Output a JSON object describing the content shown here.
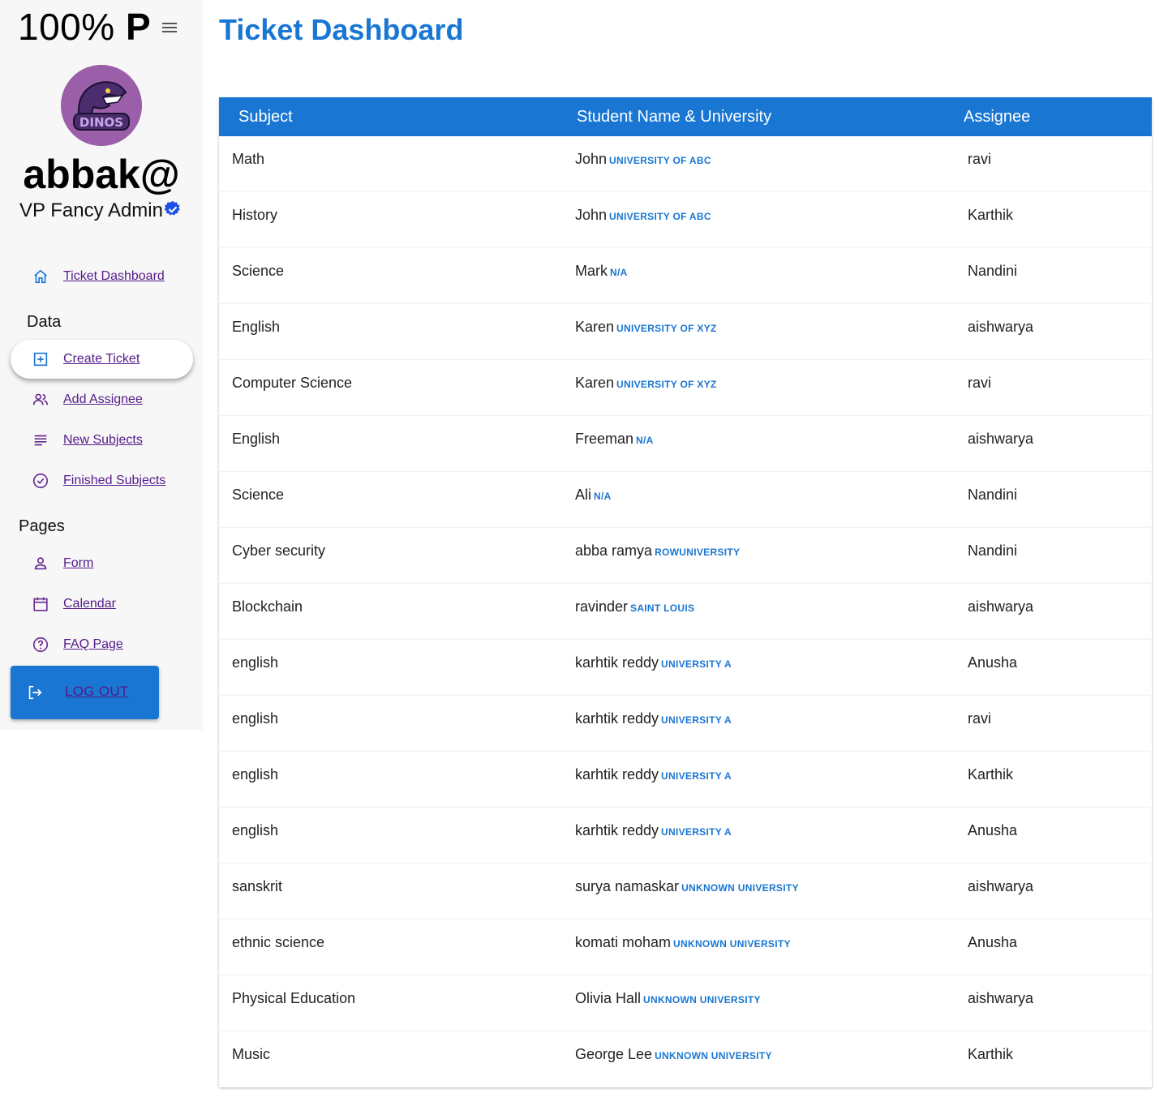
{
  "brand": {
    "prefix": "100%",
    "suffix": "P"
  },
  "user": {
    "name": "abbak@",
    "role": "VP Fancy Admin"
  },
  "nav": {
    "ticket_dashboard": "Ticket Dashboard",
    "section_data": "Data",
    "create_ticket": "Create Ticket",
    "add_assignee": "Add Assignee",
    "new_subjects": "New Subjects",
    "finished_subjects": "Finished Subjects",
    "section_pages": "Pages",
    "form": "Form",
    "calendar": "Calendar",
    "faq": "FAQ Page",
    "logout": "LOG OUT"
  },
  "page": {
    "title": "Ticket Dashboard"
  },
  "table": {
    "headers": [
      "Subject",
      "Student Name & University",
      "Assignee"
    ],
    "rows": [
      {
        "subject": "Math",
        "student": "John",
        "university": "UNIVERSITY OF ABC",
        "assignee": "ravi"
      },
      {
        "subject": "History",
        "student": "John",
        "university": "UNIVERSITY OF ABC",
        "assignee": "Karthik"
      },
      {
        "subject": "Science",
        "student": "Mark",
        "university": "N/A",
        "assignee": "Nandini"
      },
      {
        "subject": "English",
        "student": "Karen",
        "university": "UNIVERSITY OF XYZ",
        "assignee": "aishwarya"
      },
      {
        "subject": "Computer Science",
        "student": "Karen",
        "university": "UNIVERSITY OF XYZ",
        "assignee": "ravi"
      },
      {
        "subject": "English",
        "student": "Freeman",
        "university": "N/A",
        "assignee": "aishwarya"
      },
      {
        "subject": "Science",
        "student": "Ali",
        "university": "N/A",
        "assignee": "Nandini"
      },
      {
        "subject": "Cyber security",
        "student": "abba ramya",
        "university": "ROWUNIVERSITY",
        "assignee": "Nandini"
      },
      {
        "subject": "Blockchain",
        "student": "ravinder",
        "university": "SAINT LOUIS",
        "assignee": "aishwarya"
      },
      {
        "subject": "english",
        "student": "karhtik reddy",
        "university": "UNIVERSITY A",
        "assignee": "Anusha"
      },
      {
        "subject": "english",
        "student": "karhtik reddy",
        "university": "UNIVERSITY A",
        "assignee": "ravi"
      },
      {
        "subject": "english",
        "student": "karhtik reddy",
        "university": "UNIVERSITY A",
        "assignee": "Karthik"
      },
      {
        "subject": "english",
        "student": "karhtik reddy",
        "university": "UNIVERSITY A",
        "assignee": "Anusha"
      },
      {
        "subject": "sanskrit",
        "student": "surya namaskar",
        "university": "UNKNOWN UNIVERSITY",
        "assignee": "aishwarya"
      },
      {
        "subject": "ethnic science",
        "student": "komati moham",
        "university": "UNKNOWN UNIVERSITY",
        "assignee": "Anusha"
      },
      {
        "subject": "Physical Education",
        "student": "Olivia Hall",
        "university": "UNKNOWN UNIVERSITY",
        "assignee": "aishwarya"
      },
      {
        "subject": "Music",
        "student": "George Lee",
        "university": "UNKNOWN UNIVERSITY",
        "assignee": "Karthik"
      }
    ]
  },
  "colors": {
    "primary": "#1976d2",
    "sidebar_bg": "#f7f7f7",
    "avatar_bg": "#9a5fa8",
    "link": "#551a8b"
  }
}
